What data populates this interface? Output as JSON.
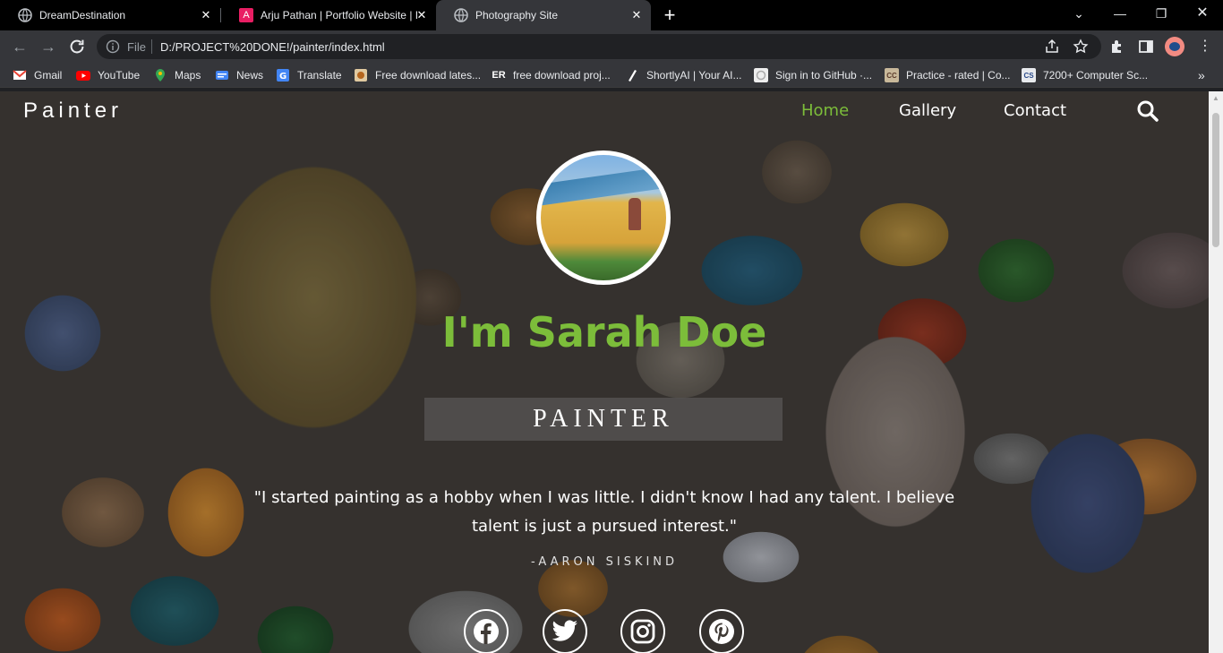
{
  "tabs": [
    {
      "title": "DreamDestination",
      "icon": "globe-icon",
      "active": false
    },
    {
      "title": "Arju Pathan | Portfolio Website | I",
      "icon": "portfolio-a-icon",
      "active": false
    },
    {
      "title": "Photography Site",
      "icon": "globe-icon",
      "active": true
    }
  ],
  "address_bar": {
    "scheme_label": "File",
    "url": "D:/PROJECT%20DONE!/painter/index.html"
  },
  "bookmarks": [
    {
      "label": "Gmail",
      "icon": "gmail-icon",
      "color": "#ea4335"
    },
    {
      "label": "YouTube",
      "icon": "youtube-icon",
      "color": "#ff0000"
    },
    {
      "label": "Maps",
      "icon": "maps-icon",
      "color": "#34a853"
    },
    {
      "label": "News",
      "icon": "news-icon",
      "color": "#4285f4"
    },
    {
      "label": "Translate",
      "icon": "translate-icon",
      "color": "#4285f4"
    },
    {
      "label": "Free download lates...",
      "icon": "download-site-icon",
      "color": "#b5651d"
    },
    {
      "label": "free download proj...",
      "icon": "er-icon",
      "color": "#35363a"
    },
    {
      "label": "ShortlyAI | Your AI...",
      "icon": "shortlyai-icon",
      "color": "#111111"
    },
    {
      "label": "Sign in to GitHub ·...",
      "icon": "github-icon",
      "color": "#eeeeee"
    },
    {
      "label": "Practice - rated | Co...",
      "icon": "codechef-icon",
      "color": "#8a6a4a"
    },
    {
      "label": "7200+ Computer Sc...",
      "icon": "cs-icon",
      "color": "#2a4a8a"
    }
  ],
  "site": {
    "brand": "Painter",
    "nav": [
      {
        "label": "Home",
        "active": true
      },
      {
        "label": "Gallery",
        "active": false
      },
      {
        "label": "Contact",
        "active": false
      }
    ],
    "headline": "I'm Sarah Doe",
    "role": "PAINTER",
    "quote": "\"I started painting as a hobby when I was little. I didn't know I had any talent. I believe talent is just a pursued interest.\"",
    "author": "-AARON SISKIND",
    "social": [
      "facebook-icon",
      "twitter-icon",
      "instagram-icon",
      "pinterest-icon"
    ],
    "accent_color": "#7cbd3a"
  }
}
